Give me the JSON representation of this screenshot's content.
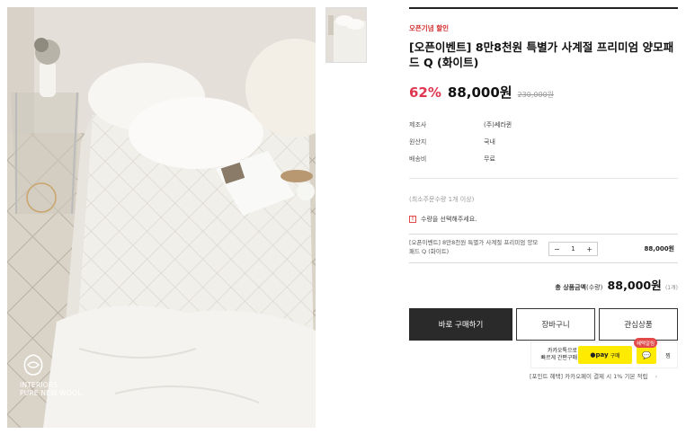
{
  "gallery": {
    "woolmark_line1": "INTERIORS",
    "woolmark_line2": "PURE NEW WOOL"
  },
  "product": {
    "event_tag": "오픈기념 할인",
    "title": "[오픈이벤트] 8만8천원 특별가 사계절 프리미엄 양모패드 Q (화이트)",
    "discount": "62%",
    "price": "88,000원",
    "original_price": "230,000원"
  },
  "specs": [
    {
      "key": "제조사",
      "value": "(주)쎄라퀸"
    },
    {
      "key": "원산지",
      "value": "국내"
    },
    {
      "key": "배송비",
      "value": "무료"
    }
  ],
  "order": {
    "min_order": "(최소주문수량 1개 이상)",
    "notice": "수량을 선택해주세요.",
    "option_name": "[오픈이벤트] 8만8천원 특별가 사계절 프리미엄 양모패드 Q (화이트)",
    "qty_minus": "−",
    "qty_value": "1",
    "qty_plus": "+",
    "option_price": "88,000원",
    "total_label": "총 상품금액",
    "total_qty_label": "(수량)",
    "total_price": "88,000원",
    "total_count": "(1개)"
  },
  "buttons": {
    "buy": "바로 구매하기",
    "cart": "장바구니",
    "wish": "관심상품"
  },
  "kakao": {
    "text_line1": "카카오톡으로",
    "text_line2": "빠르게 간편구매",
    "pay_label": "●pay",
    "pay_sub": "구매",
    "badge": "혜택알림",
    "talk_icon": "💬",
    "wish_label": "찜",
    "point_note": "[포인트 혜택] 카카오페이 결제 시 1% 기본 적립",
    "point_chevron": "›"
  },
  "colors": {
    "accent_red": "#e0364f",
    "event_red": "#d42a2a",
    "kakao_yellow": "#ffeb00",
    "buy_button": "#2a2a2a"
  }
}
